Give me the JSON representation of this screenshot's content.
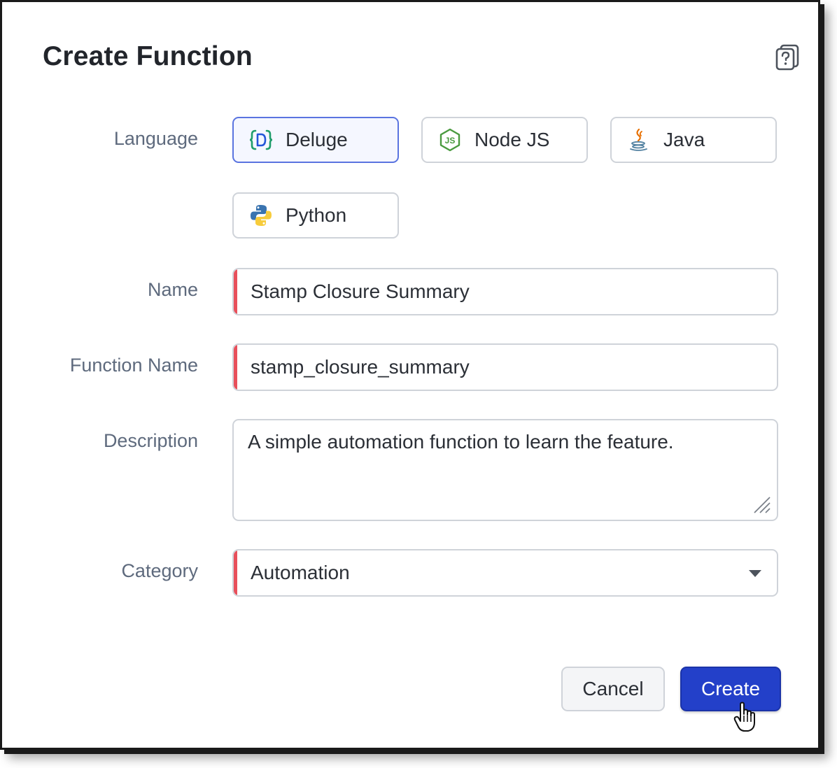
{
  "dialog": {
    "title": "Create Function",
    "help_icon": "help-book-icon"
  },
  "language": {
    "label": "Language",
    "options": [
      {
        "label": "Deluge",
        "icon": "deluge-icon",
        "selected": true
      },
      {
        "label": "Node JS",
        "icon": "nodejs-icon",
        "selected": false
      },
      {
        "label": "Java",
        "icon": "java-icon",
        "selected": false
      },
      {
        "label": "Python",
        "icon": "python-icon",
        "selected": false
      }
    ]
  },
  "name": {
    "label": "Name",
    "value": "Stamp Closure Summary",
    "required": true
  },
  "function_name": {
    "label": "Function Name",
    "value": "stamp_closure_summary",
    "required": true
  },
  "description": {
    "label": "Description",
    "value": "A simple automation function to learn the feature."
  },
  "category": {
    "label": "Category",
    "value": "Automation",
    "required": true
  },
  "buttons": {
    "cancel": "Cancel",
    "create": "Create"
  },
  "colors": {
    "primary": "#2340c9",
    "required_marker": "#e8505b",
    "selected_border": "#5a74e0"
  }
}
